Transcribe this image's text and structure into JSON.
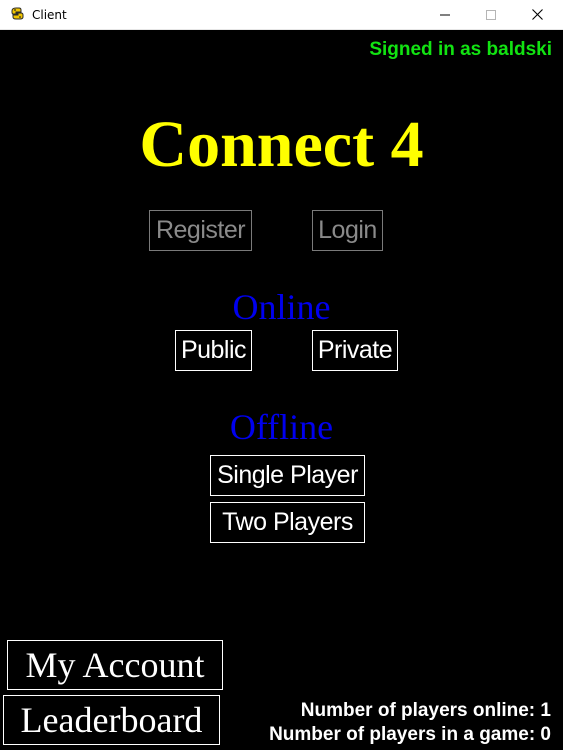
{
  "window": {
    "title": "Client",
    "icon": "python-snake-icon",
    "controls": {
      "minimize": "minimize-icon",
      "maximize": "maximize-icon",
      "close": "close-icon"
    }
  },
  "status": {
    "signed_in_text": "Signed in as baldski",
    "signed_in_color": "#12e312"
  },
  "main": {
    "title": "Connect 4",
    "title_color": "#ffff00",
    "auth": {
      "register_label": "Register",
      "login_label": "Login",
      "disabled": true
    },
    "online": {
      "heading": "Online",
      "public_label": "Public",
      "private_label": "Private"
    },
    "offline": {
      "heading": "Offline",
      "single_player_label": "Single Player",
      "two_players_label": "Two Players"
    },
    "heading_color": "#0000ee"
  },
  "footer": {
    "my_account_label": "My Account",
    "leaderboard_label": "Leaderboard",
    "players_online_text": "Number of players online: 1",
    "players_in_game_text": "Number of players in a game: 0"
  },
  "colors": {
    "background": "#000000",
    "button_border": "#ffffff",
    "disabled": "#8a8a8a"
  }
}
